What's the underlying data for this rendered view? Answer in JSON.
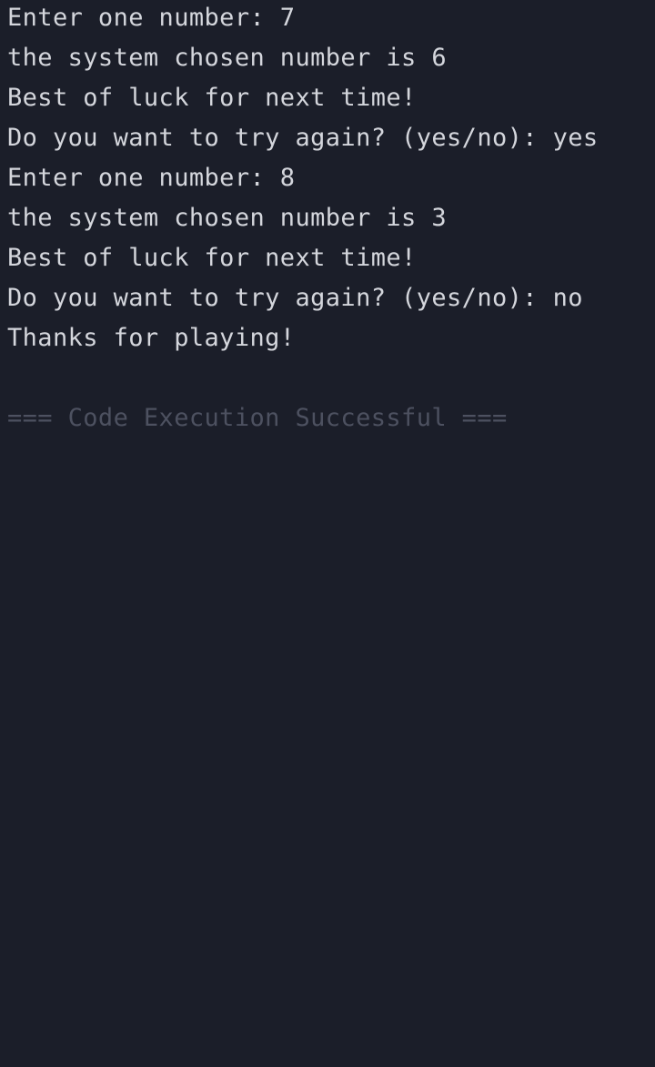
{
  "console": {
    "lines": [
      "Enter one number: 7",
      "the system chosen number is 6",
      "Best of luck for next time!",
      "Do you want to try again? (yes/no): yes",
      "Enter one number: 8",
      "the system chosen number is 3",
      "Best of luck for next time!",
      "Do you want to try again? (yes/no): no",
      "Thanks for playing!"
    ],
    "status": "=== Code Execution Successful ==="
  },
  "colors": {
    "background": "#1b1e29",
    "text": "#d4d6dc",
    "status": "#4d5160"
  }
}
